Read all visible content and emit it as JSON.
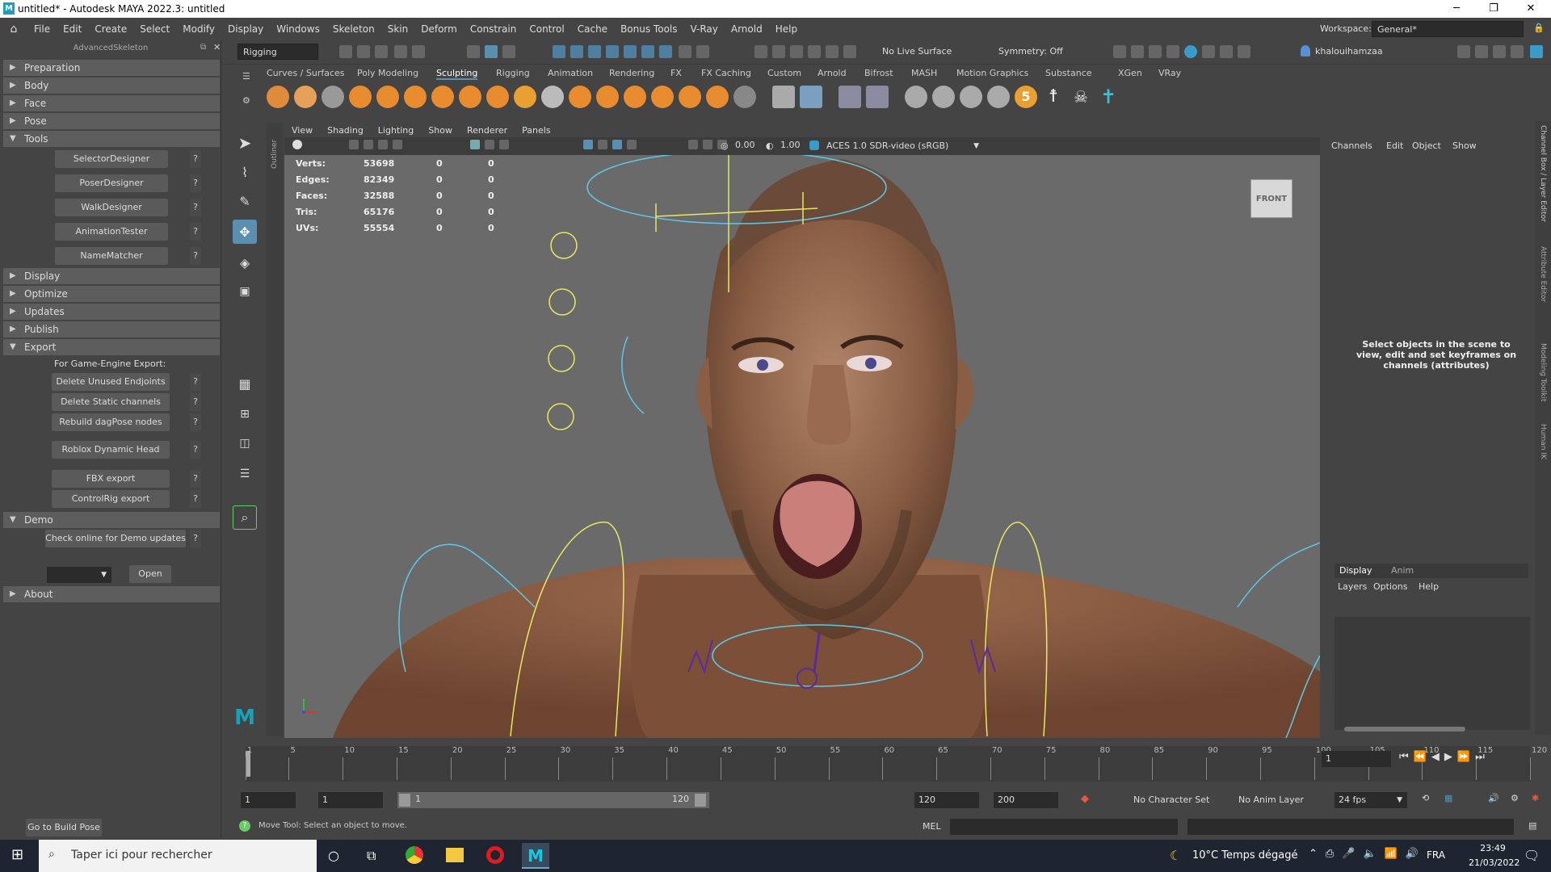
{
  "window": {
    "title": "untitled* - Autodesk MAYA 2022.3: untitled",
    "logo": "M"
  },
  "window_controls": {
    "minimize": "─",
    "restore": "❐",
    "close": "✕"
  },
  "menu": [
    "File",
    "Edit",
    "Create",
    "Select",
    "Modify",
    "Display",
    "Windows",
    "Skeleton",
    "Skin",
    "Deform",
    "Constrain",
    "Control",
    "Cache",
    "Bonus Tools",
    "V-Ray",
    "Arnold",
    "Help"
  ],
  "workspace": {
    "label": "Workspace:",
    "value": "General*"
  },
  "toolbar": {
    "menuset": "Rigging",
    "live_surface": "No Live Surface",
    "symmetry": "Symmetry: Off",
    "user": "khalouihamzaa"
  },
  "left_panel": {
    "title": "AdvancedSkeleton",
    "sections_top": [
      "Preparation",
      "Body",
      "Face",
      "Pose"
    ],
    "tools_label": "Tools",
    "tools_buttons": [
      "SelectorDesigner",
      "PoserDesigner",
      "WalkDesigner",
      "AnimationTester",
      "NameMatcher"
    ],
    "sections_mid": [
      "Display",
      "Optimize",
      "Updates",
      "Publish"
    ],
    "export_label": "Export",
    "export_caption": "For Game-Engine Export:",
    "export_buttons": [
      "Delete Unused Endjoints",
      "Delete Static channels",
      "Rebuild dagPose nodes",
      "Roblox Dynamic Head",
      "FBX export",
      "ControlRig export"
    ],
    "demo_label": "Demo",
    "demo_button": "Check online for Demo updates",
    "open_button": "Open",
    "about_label": "About",
    "help": "?",
    "build_pose": "Go to Build Pose"
  },
  "shelf_tabs": [
    "Curves / Surfaces",
    "Poly Modeling",
    "Sculpting",
    "Rigging",
    "Animation",
    "Rendering",
    "FX",
    "FX Caching",
    "Custom",
    "Arnold",
    "Bifrost",
    "MASH",
    "Motion Graphics",
    "Substance",
    "XGen",
    "VRay"
  ],
  "shelf_active": "Sculpting",
  "viewport": {
    "menu": [
      "View",
      "Shading",
      "Lighting",
      "Show",
      "Renderer",
      "Panels"
    ],
    "exposure": "0.00",
    "gamma": "1.00",
    "colorspace": "ACES 1.0 SDR-video (sRGB)",
    "cube_label": "FRONT",
    "stats": [
      {
        "label": "Verts:",
        "a": "53698",
        "b": "0",
        "c": "0"
      },
      {
        "label": "Edges:",
        "a": "82349",
        "b": "0",
        "c": "0"
      },
      {
        "label": "Faces:",
        "a": "32588",
        "b": "0",
        "c": "0"
      },
      {
        "label": "Tris:",
        "a": "65176",
        "b": "0",
        "c": "0"
      },
      {
        "label": "UVs:",
        "a": "55554",
        "b": "0",
        "c": "0"
      }
    ]
  },
  "outliner_label": "Outliner",
  "channel_box": {
    "menu": [
      "Channels",
      "Edit",
      "Object",
      "Show"
    ],
    "message": "Select objects in the scene to view, edit and set keyframes on channels (attributes)"
  },
  "layer_editor": {
    "tabs": [
      "Display",
      "Anim"
    ],
    "menu": [
      "Layers",
      "Options",
      "Help"
    ]
  },
  "side_tabs": [
    "Channel Box / Layer Editor",
    "Attribute Editor",
    "Modeling Toolkit",
    "Human IK"
  ],
  "timeline": {
    "ticks": [
      "1",
      "5",
      "10",
      "15",
      "20",
      "25",
      "30",
      "35",
      "40",
      "45",
      "50",
      "55",
      "60",
      "65",
      "70",
      "75",
      "80",
      "85",
      "90",
      "95",
      "100",
      "105",
      "110",
      "115",
      "120"
    ],
    "current_frame": "1"
  },
  "range": {
    "start": "1",
    "start2": "1",
    "slider_start": "1",
    "slider_end": "120",
    "end": "120",
    "end2": "200",
    "character_set": "No Character Set",
    "anim_layer": "No Anim Layer",
    "fps": "24 fps"
  },
  "status": {
    "help_line": "Move Tool: Select an object to move.",
    "mel": "MEL"
  },
  "taskbar": {
    "search": "Taper ici pour rechercher",
    "weather": "10°C  Temps dégagé",
    "lang": "FRA",
    "time": "23:49",
    "date": "21/03/2022"
  }
}
